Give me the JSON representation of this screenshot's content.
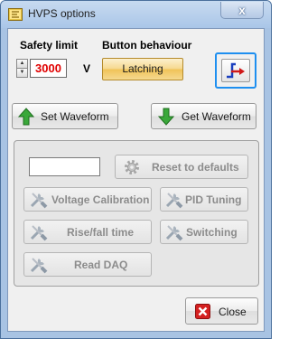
{
  "window": {
    "title": "HVPS options",
    "close_glyph": "x"
  },
  "safety": {
    "label": "Safety limit",
    "value": "3000",
    "unit": "V"
  },
  "button_behaviour": {
    "label": "Button behaviour",
    "mode": "Latching"
  },
  "waveform": {
    "set_label": "Set Waveform",
    "get_label": "Get Waveform"
  },
  "advanced": {
    "reset_label": "Reset to defaults",
    "voltage_calibration_label": "Voltage Calibration",
    "pid_tuning_label": "PID Tuning",
    "rise_fall_label": "Rise/fall time",
    "switching_label": "Switching",
    "read_daq_label": "Read DAQ"
  },
  "footer": {
    "close_label": "Close"
  },
  "colors": {
    "accent_focus": "#1e8ff0",
    "value_text": "#e00000",
    "latching_bg": "#f0c257",
    "green_arrow": "#3aa83a",
    "close_red": "#d42020"
  },
  "icons": {
    "app": "app-icon",
    "waveform": "step-waveform-icon",
    "set": "arrow-up-icon",
    "get": "arrow-down-icon",
    "reset": "gear-icon",
    "tools": "wrench-screwdriver-icon",
    "close": "close-icon"
  }
}
